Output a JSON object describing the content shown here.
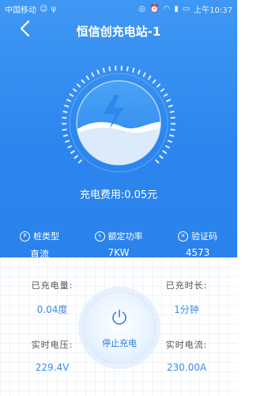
{
  "status_bar": {
    "carrier": "中国移动",
    "time": "上午10:37"
  },
  "header": {
    "title": "恒信创充电站-1"
  },
  "fee": {
    "label": "充电费用:0.05元"
  },
  "stats": [
    {
      "label": "桩类型",
      "value": "直流",
      "icon": "P"
    },
    {
      "label": "额定功率",
      "value": "7KW",
      "icon": "bolt"
    },
    {
      "label": "验证码",
      "value": "4573",
      "icon": "✕"
    }
  ],
  "info": {
    "charged_amount_label": "已充电量:",
    "charged_amount_value": "0.04度",
    "charged_duration_label": "已充时长:",
    "charged_duration_value": "1分钟",
    "voltage_label": "实时电压:",
    "voltage_value": "229.4V",
    "current_label": "实时电流:",
    "current_value": "230.00A"
  },
  "stop_button": {
    "label": "停止充电"
  },
  "colors": {
    "primary": "#2d86ee",
    "value_blue": "#3a8be8"
  }
}
